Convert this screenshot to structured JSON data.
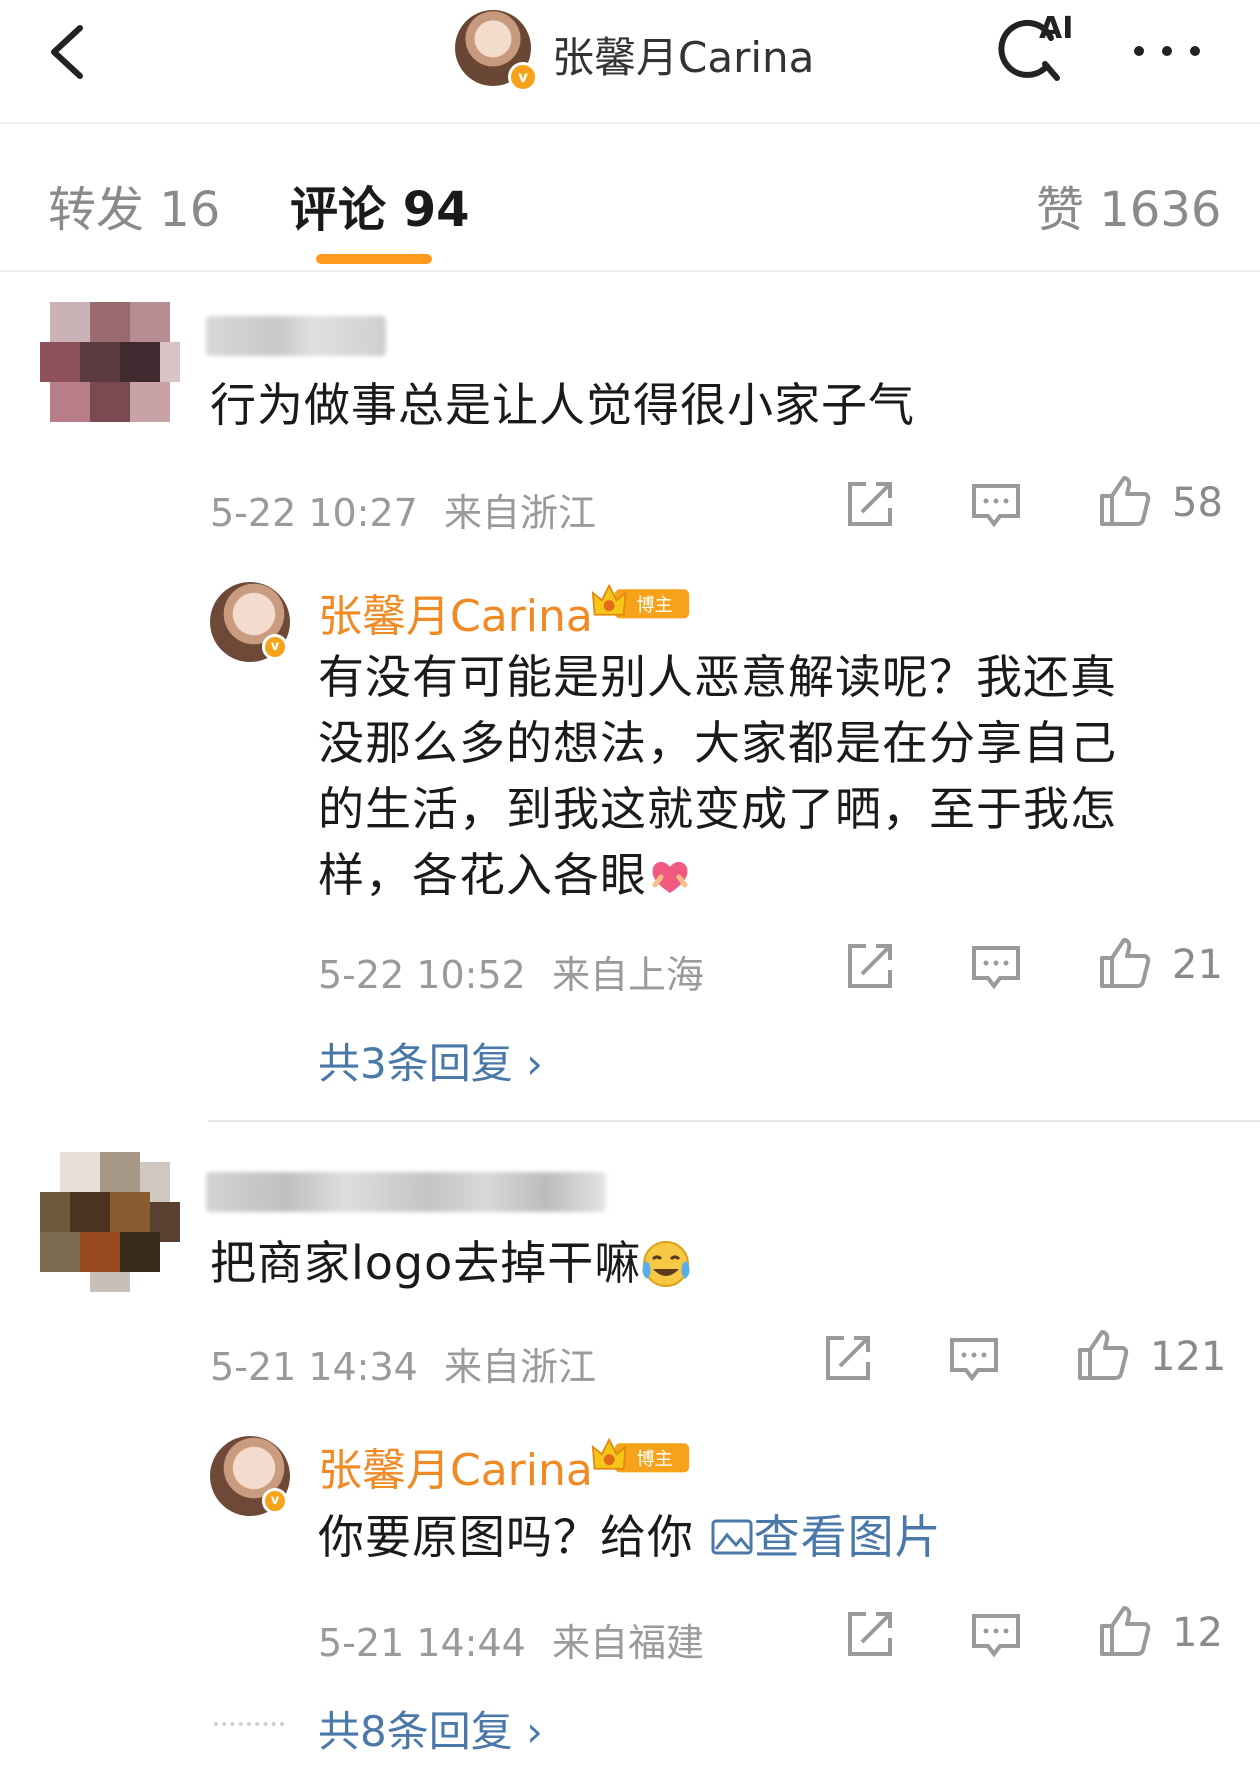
{
  "header": {
    "title": "张馨月Carina",
    "verified_mark": "v"
  },
  "tabs": [
    {
      "label": "转发 16"
    },
    {
      "label": "评论 94"
    },
    {
      "label": "赞 1636"
    }
  ],
  "ai_badge": "AI",
  "blogger_badge": "博主",
  "comments": [
    {
      "text": "行为做事总是让人觉得很小家子气",
      "time": "5-22 10:27",
      "location": "来自浙江",
      "likes": "58",
      "reply": {
        "name": "张馨月Carina",
        "text_lines": [
          "有没有可能是别人恶意解读呢？我还真",
          "没那么多的想法，大家都是在分享自己",
          "的生活，到我这就变成了晒，至于我怎",
          "样，各花入各眼"
        ],
        "time": "5-22 10:52",
        "location": "来自上海",
        "likes": "21"
      },
      "more_replies": "共3条回复 ›"
    },
    {
      "text": "把商家logo去掉干嘛",
      "time": "5-21 14:34",
      "location": "来自浙江",
      "likes": "121",
      "reply": {
        "name": "张馨月Carina",
        "text": "你要原图吗？给你 ",
        "link": "查看图片",
        "time": "5-21 14:44",
        "location": "来自福建",
        "likes": "12"
      },
      "more_replies": "共8条回复 ›"
    }
  ],
  "colors": {
    "accent_orange": "#ff9a1f",
    "name_orange": "#f08a24",
    "link_blue": "#4a78a8",
    "meta_gray": "#9a9a9a",
    "verified": "#f7a21b"
  },
  "icons": [
    "back-chevron-icon",
    "ai-search-icon",
    "more-dots-icon",
    "repost-icon",
    "comment-icon",
    "thumbs-up-icon",
    "image-icon",
    "heart-emoji-icon",
    "laughing-crying-emoji-icon",
    "crown-icon"
  ]
}
